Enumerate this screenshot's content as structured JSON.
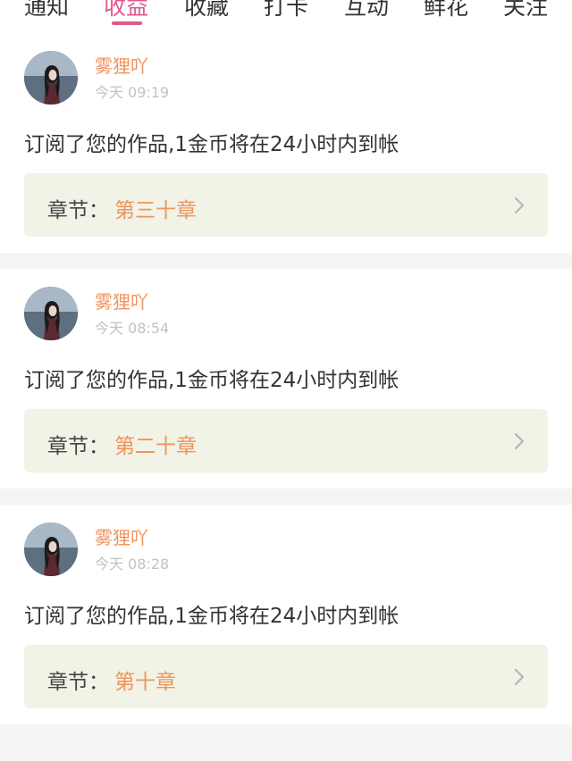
{
  "tabs": [
    {
      "label": "通知",
      "active": false
    },
    {
      "label": "收益",
      "active": true
    },
    {
      "label": "收藏",
      "active": false
    },
    {
      "label": "打卡",
      "active": false
    },
    {
      "label": "互动",
      "active": false
    },
    {
      "label": "鲜花",
      "active": false
    },
    {
      "label": "关注",
      "active": false
    }
  ],
  "notifications": [
    {
      "user": "雾狸吖",
      "time": "今天 09:19",
      "message": "订阅了您的作品,1金币将在24小时内到帐",
      "chapter_label": "章节：",
      "chapter_value": "第三十章"
    },
    {
      "user": "雾狸吖",
      "time": "今天 08:54",
      "message": "订阅了您的作品,1金币将在24小时内到帐",
      "chapter_label": "章节：",
      "chapter_value": "第二十章"
    },
    {
      "user": "雾狸吖",
      "time": "今天 08:28",
      "message": "订阅了您的作品,1金币将在24小时内到帐",
      "chapter_label": "章节：",
      "chapter_value": "第十章"
    }
  ],
  "colors": {
    "accent": "#e2588e",
    "name_orange": "#f0935f",
    "chapter_bg": "#f1f3e6"
  }
}
